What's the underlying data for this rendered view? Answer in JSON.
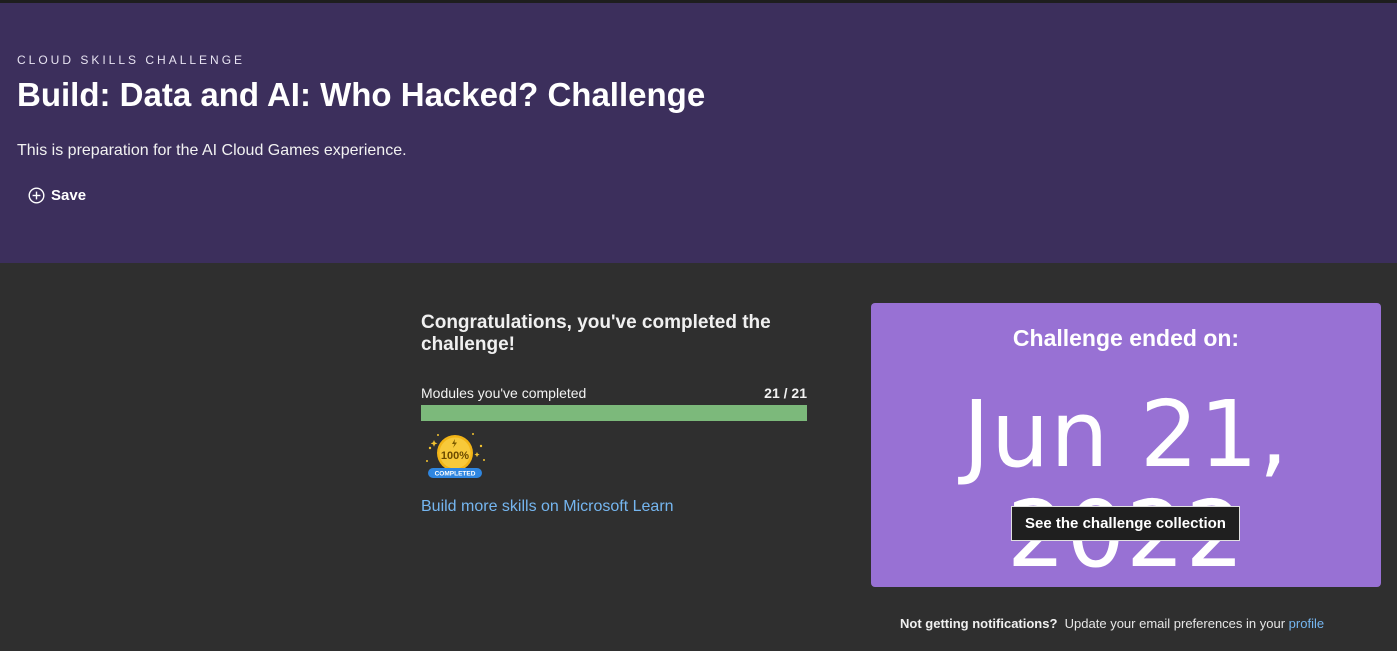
{
  "hero": {
    "eyebrow": "CLOUD SKILLS CHALLENGE",
    "title": "Build: Data and AI: Who Hacked? Challenge",
    "description": "This is preparation for the AI Cloud Games experience.",
    "save_label": "Save",
    "background_color": "#3c2f5c"
  },
  "progress": {
    "heading": "Congratulations, you've completed the challenge!",
    "modules_label": "Modules you've completed",
    "modules_count": "21 / 21",
    "completed": 21,
    "total": 21,
    "bar_color": "#7cb97b",
    "badge": {
      "percent_text": "100%",
      "label": "COMPLETED",
      "icon": "completion-badge-icon"
    },
    "learn_link": "Build more skills on Microsoft Learn"
  },
  "challenge_card": {
    "ended_label": "Challenge ended on:",
    "ended_date": "Jun 21, 2022",
    "collection_button": "See the challenge collection",
    "background_color": "#9871d4"
  },
  "notifications": {
    "question": "Not getting notifications?",
    "text": "Update your email preferences in your",
    "profile_link": "profile"
  }
}
